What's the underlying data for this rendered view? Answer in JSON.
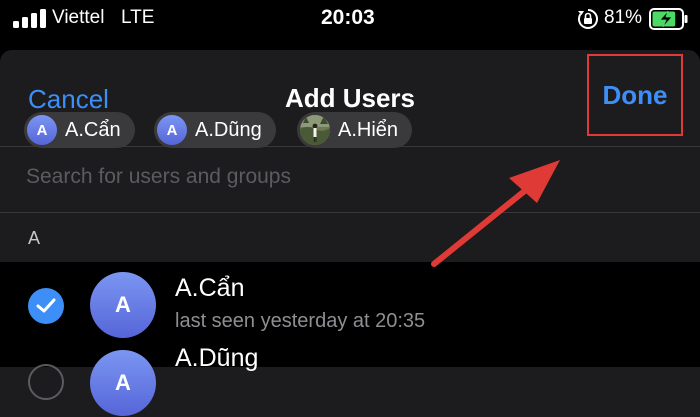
{
  "status_bar": {
    "carrier": "Viettel",
    "network": "LTE",
    "time": "20:03",
    "battery_percent": "81%",
    "battery_level": 0.81,
    "icons": [
      "signal-bars-icon",
      "orientation-lock-icon",
      "battery-charging-icon"
    ]
  },
  "nav": {
    "cancel_label": "Cancel",
    "title": "Add Users",
    "done_label": "Done"
  },
  "selected_chips": [
    {
      "initial": "A",
      "label": "A.Cẩn"
    },
    {
      "initial": "A",
      "label": "A.Dũng"
    },
    {
      "label": "A.Hiển"
    }
  ],
  "search": {
    "placeholder": "Search for users and groups",
    "value": ""
  },
  "section": {
    "header": "A"
  },
  "users": [
    {
      "initial": "A",
      "name": "A.Cẩn",
      "status": "last seen yesterday at 20:35",
      "checked": true
    },
    {
      "initial": "A",
      "name": "A.Dũng",
      "status": "",
      "checked": false
    }
  ],
  "colors": {
    "accent": "#3e8ef7",
    "highlight": "#e03a36",
    "background": "#1c1c1e",
    "avatar_gradient_top": "#7b96f2",
    "avatar_gradient_bottom": "#5665d8"
  }
}
